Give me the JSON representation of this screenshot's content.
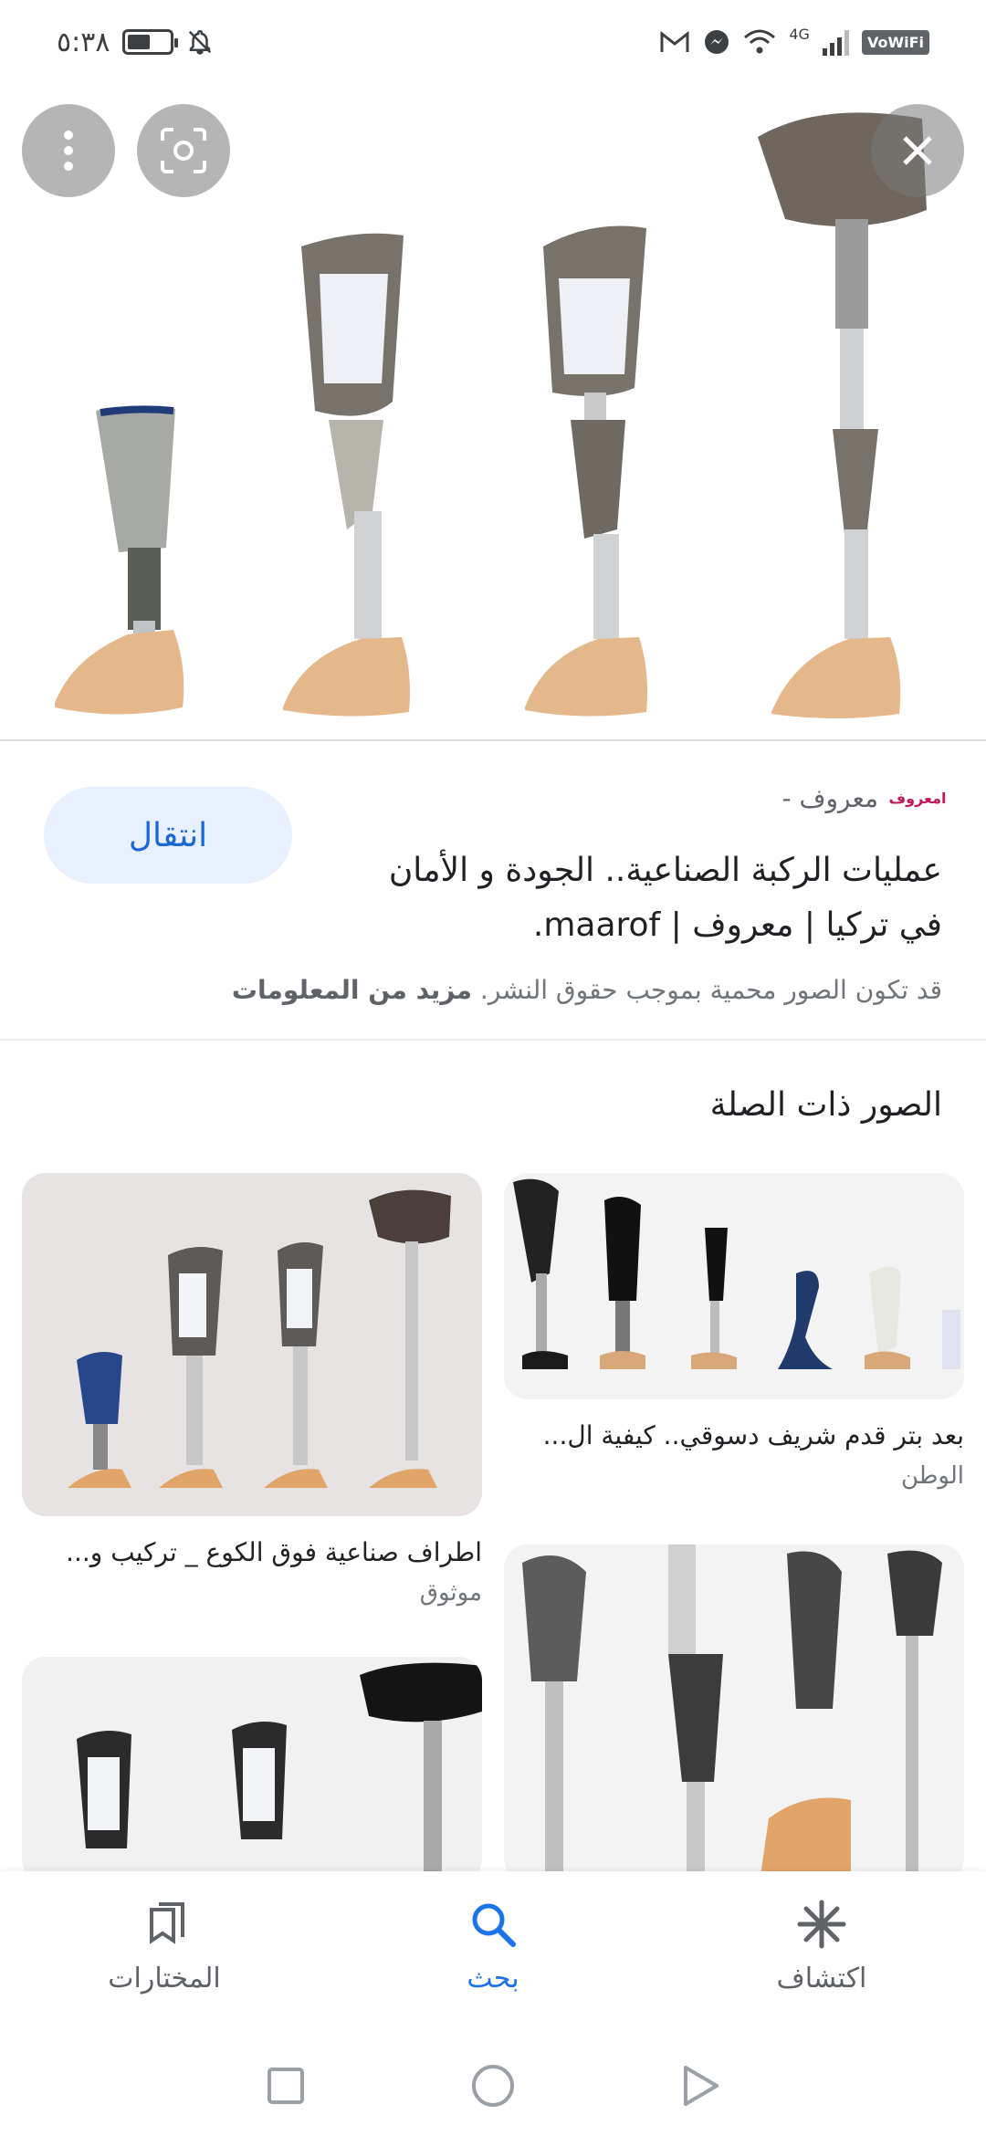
{
  "status_bar": {
    "time": "٥:٣٨",
    "network_label": "4G",
    "wifi_calling_label": "VoWiFi",
    "battery_level": 0.55
  },
  "hero": {
    "more_icon": "more-vert-icon",
    "lens_icon": "lens-icon",
    "close_icon": "close-icon"
  },
  "result": {
    "source_logo_text": "امعروف",
    "source_name": "معروف -",
    "visit_label": "انتقال",
    "title": "عمليات الركبة الصناعية.. الجودة و الأمان في تركيا | معروف | maarof.",
    "notice_text": "قد تكون الصور محمية بموجب حقوق النشر.",
    "notice_link": "مزيد من المعلومات"
  },
  "related": {
    "heading": "الصور ذات الصلة",
    "items": [
      {
        "caption": "بعد بتر قدم شريف دسوقي.. كيفية ال...",
        "source": "الوطن"
      },
      {
        "caption": "اطراف صناعية فوق الكوع _ تركيب و...",
        "source": "موثوق"
      },
      {
        "caption": "",
        "source": ""
      },
      {
        "caption": "",
        "source": ""
      }
    ]
  },
  "bottom_nav": {
    "items": [
      {
        "label": "المختارات",
        "icon": "bookmarks-icon",
        "active": false
      },
      {
        "label": "بحث",
        "icon": "search-icon",
        "active": true
      },
      {
        "label": "اكتشاف",
        "icon": "discover-asterisk-icon",
        "active": false
      }
    ]
  },
  "colors": {
    "accent": "#1a73e8",
    "visit_bg": "#e8f0fe",
    "visit_text": "#1967d2",
    "secondary_text": "#70757a"
  }
}
